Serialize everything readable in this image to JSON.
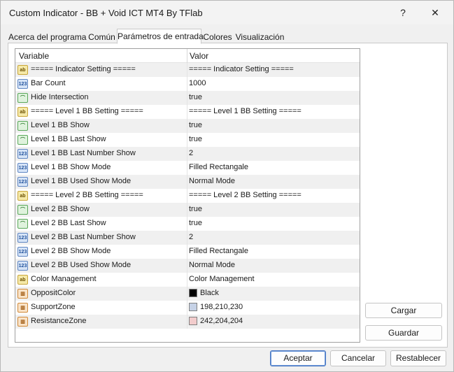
{
  "window": {
    "title": "Custom Indicator - BB + Void ICT MT4 By TFlab",
    "help_label": "?",
    "close_label": "✕"
  },
  "tabs": [
    {
      "label": "Acerca del programa",
      "active": false
    },
    {
      "label": "Común",
      "active": false
    },
    {
      "label": "Parámetros de entrada",
      "active": true
    },
    {
      "label": "Colores",
      "active": false
    },
    {
      "label": "Visualización",
      "active": false
    }
  ],
  "grid": {
    "headers": {
      "variable": "Variable",
      "value": "Valor"
    },
    "rows": [
      {
        "icon": "ab",
        "name": "===== Indicator Setting =====",
        "value": "===== Indicator Setting ====="
      },
      {
        "icon": "123",
        "name": "Bar Count",
        "value": "1000"
      },
      {
        "icon": "bool",
        "name": "Hide Intersection",
        "value": "true"
      },
      {
        "icon": "ab",
        "name": "===== Level 1 BB Setting =====",
        "value": "===== Level 1 BB Setting ====="
      },
      {
        "icon": "bool",
        "name": "Level 1 BB Show",
        "value": "true"
      },
      {
        "icon": "bool",
        "name": "Level 1 BB Last Show",
        "value": "true"
      },
      {
        "icon": "123",
        "name": "Level 1 BB Last Number Show",
        "value": "2"
      },
      {
        "icon": "123",
        "name": "Level 1 BB Show Mode",
        "value": "Filled Rectangale"
      },
      {
        "icon": "123",
        "name": "Level 1 BB Used Show Mode",
        "value": "Normal Mode"
      },
      {
        "icon": "ab",
        "name": "===== Level 2 BB Setting =====",
        "value": "===== Level 2 BB Setting ====="
      },
      {
        "icon": "bool",
        "name": "Level 2 BB Show",
        "value": "true"
      },
      {
        "icon": "bool",
        "name": "Level 2 BB Last Show",
        "value": "true"
      },
      {
        "icon": "123",
        "name": "Level 2 BB Last Number Show",
        "value": "2"
      },
      {
        "icon": "123",
        "name": "Level 2 BB Show Mode",
        "value": "Filled Rectangale"
      },
      {
        "icon": "123",
        "name": "Level 2 BB Used Show Mode",
        "value": "Normal Mode"
      },
      {
        "icon": "ab",
        "name": "Color Management",
        "value": "Color Management"
      },
      {
        "icon": "color",
        "name": "OppositColor",
        "value": "Black",
        "swatch": "#000000"
      },
      {
        "icon": "color",
        "name": "SupportZone",
        "value": "198,210,230",
        "swatch": "#c6d2e6"
      },
      {
        "icon": "color",
        "name": "ResistanceZone",
        "value": "242,204,204",
        "swatch": "#f2cccc"
      }
    ]
  },
  "side_buttons": {
    "load_label": "Cargar",
    "save_label": "Guardar"
  },
  "bottom_buttons": {
    "ok_label": "Aceptar",
    "cancel_label": "Cancelar",
    "reset_label": "Restablecer"
  },
  "icons": {
    "ab": "ab",
    "123": "123",
    "bool": "⌒",
    "color": "▥"
  }
}
